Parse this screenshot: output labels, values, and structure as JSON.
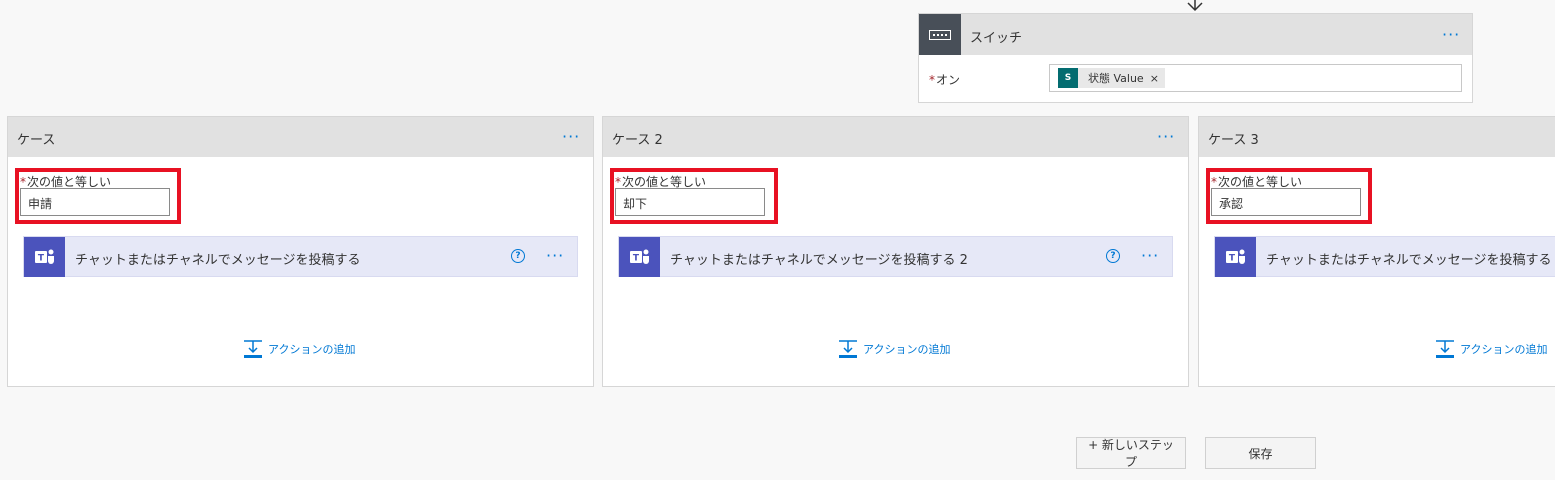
{
  "switch": {
    "title": "スイッチ",
    "on_label": "オン",
    "token_label": "状態 Value",
    "token_close": "×",
    "more": "···"
  },
  "cases": [
    {
      "title": "ケース",
      "field_label": "次の値と等しい",
      "field_value": "申請",
      "action_title": "チャットまたはチャネルでメッセージを投稿する",
      "help": "?",
      "more": "···",
      "add_action": "アクションの追加"
    },
    {
      "title": "ケース 2",
      "field_label": "次の値と等しい",
      "field_value": "却下",
      "action_title": "チャットまたはチャネルでメッセージを投稿する 2",
      "help": "?",
      "more": "···",
      "add_action": "アクションの追加"
    },
    {
      "title": "ケース 3",
      "field_label": "次の値と等しい",
      "field_value": "承認",
      "action_title": "チャットまたはチャネルでメッセージを投稿する",
      "help": "",
      "more": "",
      "add_action": "アクションの追加"
    }
  ],
  "buttons": {
    "new_step": "+ 新しいステップ",
    "save": "保存"
  },
  "colors": {
    "accent": "#0078d4",
    "highlight": "#e81123",
    "teams": "#4b53bc",
    "sharepoint": "#036c70"
  }
}
